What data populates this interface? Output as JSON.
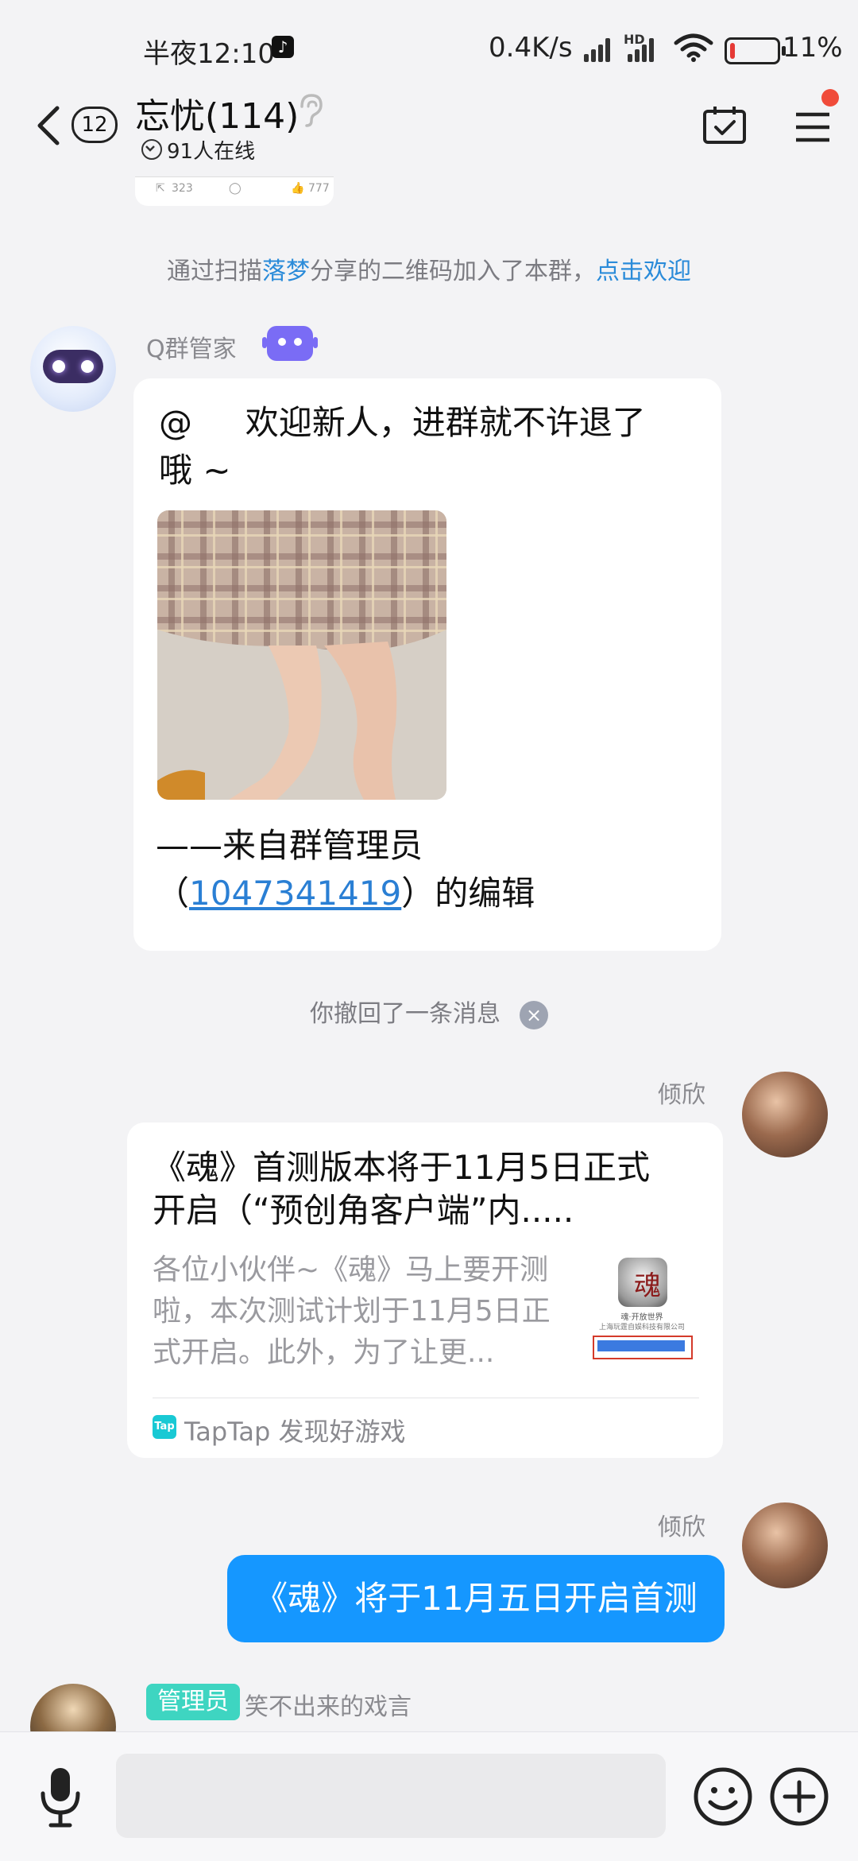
{
  "status_bar": {
    "time": "半夜12:10",
    "speed": "0.4K/s",
    "hd": "HD",
    "battery": "11%",
    "battery_percent": 11,
    "battery_color": "#e53935"
  },
  "header": {
    "unread_count": "12",
    "title": "忘忧(114)",
    "online_text": "91人在线",
    "notification_dot_color": "#f04b3a"
  },
  "partial_card": {
    "share_count": "323",
    "like_count": "777"
  },
  "messages": {
    "join_notice": {
      "prefix": "通过扫描",
      "name": "落梦",
      "middle": "分享的二维码加入了本群，",
      "action": "点击欢迎"
    },
    "bot": {
      "sender": "Q群管家",
      "line1": "@     欢迎新人，进群就不许退了",
      "line2": "哦 ~",
      "footer_prefix": "——来自群管理员",
      "footer_id_open": "（",
      "admin_id": "1047341419",
      "footer_id_close": "）的编辑"
    },
    "recall": {
      "text": "你撤回了一条消息",
      "close_symbol": "×"
    },
    "share_card": {
      "sender": "倾欣",
      "title_line1": "《魂》首测版本将于11月5日正式",
      "title_line2": "开启（“预创角客户端”内.....",
      "desc_line1": "各位小伙伴~《魂》马上要开测",
      "desc_line2": "啦，本次测试计划于11月5日正",
      "desc_line3": "式开启。此外，为了让更...",
      "source_logo": "Tap",
      "source": "TapTap 发现好游戏",
      "thumb_caption": "魂·开放世界",
      "thumb_company": "上海玩霆自娱科技有限公司"
    },
    "text_message": {
      "sender": "倾欣",
      "text": "《魂》将于11月五日开启首测"
    },
    "admin_msg": {
      "badge": "管理员",
      "sender": "笑不出来的戏言"
    }
  },
  "input_bar": {
    "placeholder": ""
  }
}
